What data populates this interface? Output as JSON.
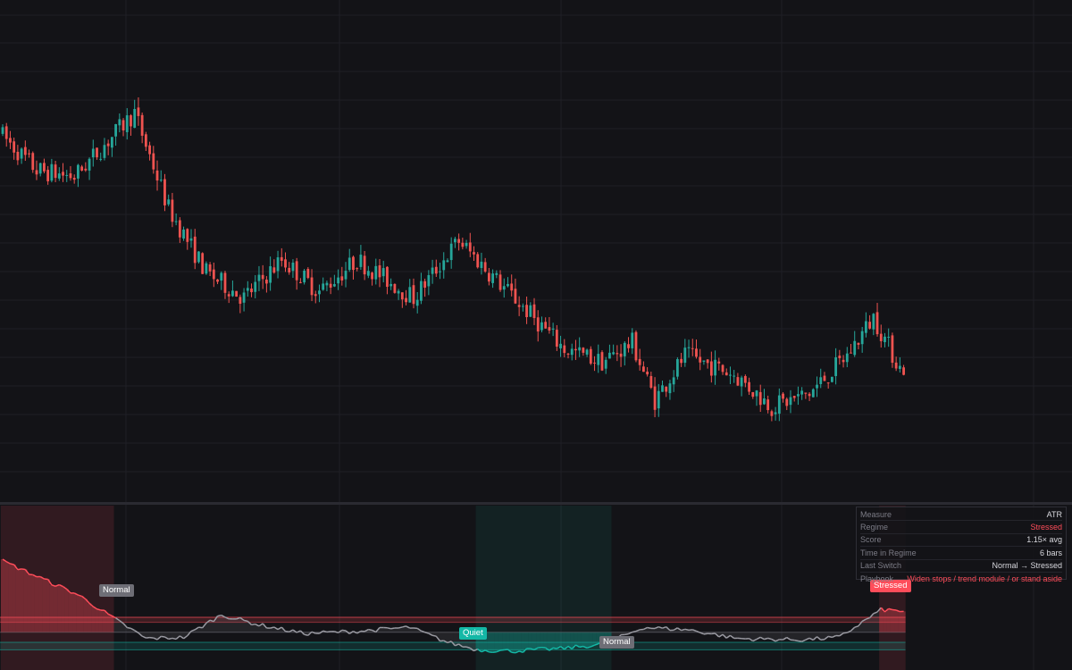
{
  "colors": {
    "background": "#131317",
    "grid": "#1f1f25",
    "up": "#26a69a",
    "down": "#ef5350",
    "stressed": "#ff4d5a",
    "quiet": "#14b8a6",
    "normal_tag": "#6e6e76",
    "score_line": "#9a9aa2",
    "panel_text": "#d8d8de",
    "panel_key": "#7c7c86"
  },
  "info_panel": {
    "rows": [
      {
        "key": "Measure",
        "value": "ATR",
        "color": "#d8d8de"
      },
      {
        "key": "Regime",
        "value": "Stressed",
        "color": "#ff4d5a"
      },
      {
        "key": "Score",
        "value": "1.15× avg",
        "color": "#d8d8de"
      },
      {
        "key": "Time in Regime",
        "value": "6 bars",
        "color": "#d8d8de"
      },
      {
        "key": "Last Switch",
        "value": "Normal → Stressed",
        "color": "#d8d8de"
      },
      {
        "key": "Playbook",
        "value": "Widen stops / trend module / or stand aside",
        "color": "#ff4d5a"
      }
    ]
  },
  "regime_labels": {
    "normal_1": "Normal",
    "quiet": "Quiet",
    "normal_2": "Normal",
    "stressed": "Stressed"
  },
  "chart_data": [
    {
      "type": "candlestick",
      "bar_count": 240,
      "price_waypoints": [
        {
          "bar": 0,
          "price": 100
        },
        {
          "bar": 10,
          "price": 94
        },
        {
          "bar": 20,
          "price": 93
        },
        {
          "bar": 28,
          "price": 98
        },
        {
          "bar": 36,
          "price": 103
        },
        {
          "bar": 45,
          "price": 88
        },
        {
          "bar": 55,
          "price": 78
        },
        {
          "bar": 65,
          "price": 74
        },
        {
          "bar": 75,
          "price": 80
        },
        {
          "bar": 85,
          "price": 75
        },
        {
          "bar": 95,
          "price": 80
        },
        {
          "bar": 110,
          "price": 74
        },
        {
          "bar": 122,
          "price": 83
        },
        {
          "bar": 130,
          "price": 78
        },
        {
          "bar": 140,
          "price": 72
        },
        {
          "bar": 150,
          "price": 66
        },
        {
          "bar": 160,
          "price": 64
        },
        {
          "bar": 168,
          "price": 67
        },
        {
          "bar": 174,
          "price": 58
        },
        {
          "bar": 182,
          "price": 65
        },
        {
          "bar": 195,
          "price": 62
        },
        {
          "bar": 205,
          "price": 57
        },
        {
          "bar": 215,
          "price": 59
        },
        {
          "bar": 225,
          "price": 65
        },
        {
          "bar": 232,
          "price": 71
        },
        {
          "bar": 239,
          "price": 63
        }
      ]
    },
    {
      "type": "line",
      "series": [
        {
          "name": "Score"
        }
      ],
      "bands": [
        "Stressed",
        "Normal",
        "Quiet"
      ],
      "score_waypoints": [
        {
          "bar": 0,
          "value": 1.55
        },
        {
          "bar": 20,
          "value": 1.28
        },
        {
          "bar": 30,
          "value": 1.08
        },
        {
          "bar": 38,
          "value": 0.93
        },
        {
          "bar": 48,
          "value": 0.94
        },
        {
          "bar": 58,
          "value": 1.12
        },
        {
          "bar": 68,
          "value": 1.04
        },
        {
          "bar": 80,
          "value": 0.97
        },
        {
          "bar": 95,
          "value": 0.99
        },
        {
          "bar": 108,
          "value": 1.02
        },
        {
          "bar": 118,
          "value": 0.9
        },
        {
          "bar": 126,
          "value": 0.84
        },
        {
          "bar": 135,
          "value": 0.83
        },
        {
          "bar": 148,
          "value": 0.85
        },
        {
          "bar": 158,
          "value": 0.88
        },
        {
          "bar": 163,
          "value": 0.93
        },
        {
          "bar": 170,
          "value": 1.02
        },
        {
          "bar": 182,
          "value": 1.0
        },
        {
          "bar": 195,
          "value": 0.93
        },
        {
          "bar": 212,
          "value": 0.92
        },
        {
          "bar": 222,
          "value": 0.94
        },
        {
          "bar": 228,
          "value": 1.06
        },
        {
          "bar": 233,
          "value": 1.16
        },
        {
          "bar": 239,
          "value": 1.15
        }
      ],
      "regimes": [
        {
          "from": 0,
          "to": 29,
          "regime": "Stressed"
        },
        {
          "from": 30,
          "to": 125,
          "regime": "Normal"
        },
        {
          "from": 126,
          "to": 161,
          "regime": "Quiet"
        },
        {
          "from": 162,
          "to": 232,
          "regime": "Normal"
        },
        {
          "from": 233,
          "to": 239,
          "regime": "Stressed"
        }
      ]
    }
  ]
}
